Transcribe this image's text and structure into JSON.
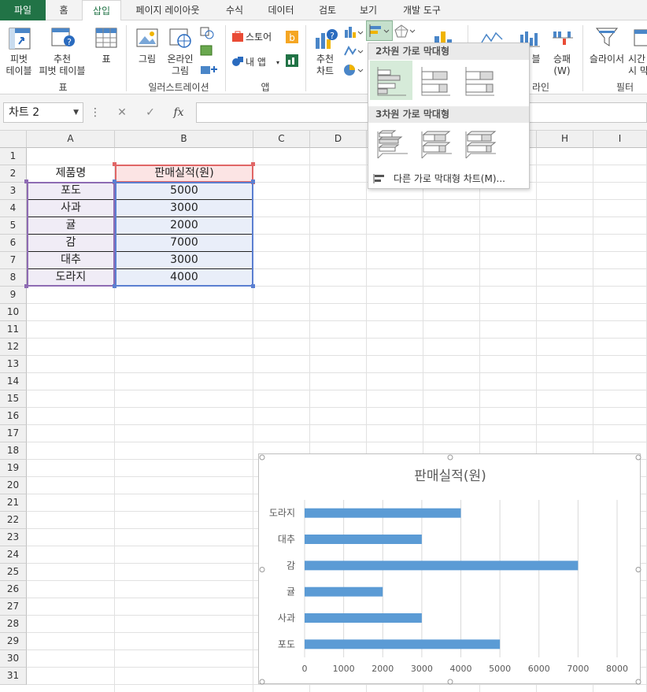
{
  "tabs": [
    {
      "label": "파일",
      "x": 0,
      "w": 58,
      "kind": "file"
    },
    {
      "label": "홈",
      "x": 58,
      "w": 46
    },
    {
      "label": "삽입",
      "x": 104,
      "w": 50,
      "kind": "active"
    },
    {
      "label": "페이지 레이아웃",
      "x": 154,
      "w": 118
    },
    {
      "label": "수식",
      "x": 272,
      "w": 52
    },
    {
      "label": "데이터",
      "x": 324,
      "w": 66
    },
    {
      "label": "검토",
      "x": 390,
      "w": 52
    },
    {
      "label": "보기",
      "x": 442,
      "w": 52
    },
    {
      "label": "개발 도구",
      "x": 494,
      "w": 84
    }
  ],
  "ribbon": {
    "pivot": "피벗\n테이블",
    "recpivot": "추천\n피벗 테이블",
    "table": "표",
    "grp_table": "표",
    "picture": "그림",
    "online": "온라인\n그림",
    "grp_illust": "일러스트레이션",
    "store": "스토어",
    "myapps": "내 앱",
    "grp_apps": "앱",
    "recchart": "추천\n차트",
    "winloss": "승패\n(W)",
    "slicer": "슬라이서",
    "timeline": "시간\n시 막",
    "grp_filter": "필터",
    "grp_spark_partial": "라인",
    "partial_label": "블"
  },
  "formula": {
    "namebox": "차트 2",
    "fx": "fx",
    "cancel": "✕",
    "enter": "✓",
    "formula_value": ""
  },
  "columns": [
    {
      "label": "",
      "x": 0,
      "w": 34
    },
    {
      "label": "A",
      "x": 34,
      "w": 112
    },
    {
      "label": "B",
      "x": 146,
      "w": 176
    },
    {
      "label": "C",
      "x": 322,
      "w": 72
    },
    {
      "label": "D",
      "x": 394,
      "w": 72
    },
    {
      "label": "E",
      "x": 466,
      "w": 72
    },
    {
      "label": "F",
      "x": 538,
      "w": 72
    },
    {
      "label": "G",
      "x": 610,
      "w": 72
    },
    {
      "label": "H",
      "x": 682,
      "w": 72
    },
    {
      "label": "I",
      "x": 754,
      "w": 68
    }
  ],
  "rows": [
    "1",
    "2",
    "3",
    "4",
    "5",
    "6",
    "7",
    "8",
    "9",
    "10",
    "11",
    "12",
    "13",
    "14",
    "15",
    "16",
    "17",
    "18",
    "19",
    "20",
    "21",
    "22",
    "23",
    "24",
    "25",
    "26",
    "27",
    "28",
    "29",
    "30",
    "31"
  ],
  "table": {
    "header": [
      "제품명",
      "판매실적(원)"
    ],
    "rows": [
      [
        "포도",
        "5000"
      ],
      [
        "사과",
        "3000"
      ],
      [
        "귤",
        "2000"
      ],
      [
        "감",
        "7000"
      ],
      [
        "대추",
        "3000"
      ],
      [
        "도라지",
        "4000"
      ]
    ]
  },
  "dropdown": {
    "section2d": "2차원 가로 막대형",
    "section3d": "3차원 가로 막대형",
    "more": "다른 가로 막대형 차트(M)..."
  },
  "chart_data": {
    "type": "bar",
    "orientation": "horizontal",
    "title": "판매실적(원)",
    "categories": [
      "포도",
      "사과",
      "귤",
      "감",
      "대추",
      "도라지"
    ],
    "values": [
      5000,
      3000,
      2000,
      7000,
      3000,
      4000
    ],
    "xlim": [
      0,
      8000
    ],
    "xticks": [
      0,
      1000,
      2000,
      3000,
      4000,
      5000,
      6000,
      7000,
      8000
    ],
    "grid": true,
    "color": "#5b9bd5"
  }
}
